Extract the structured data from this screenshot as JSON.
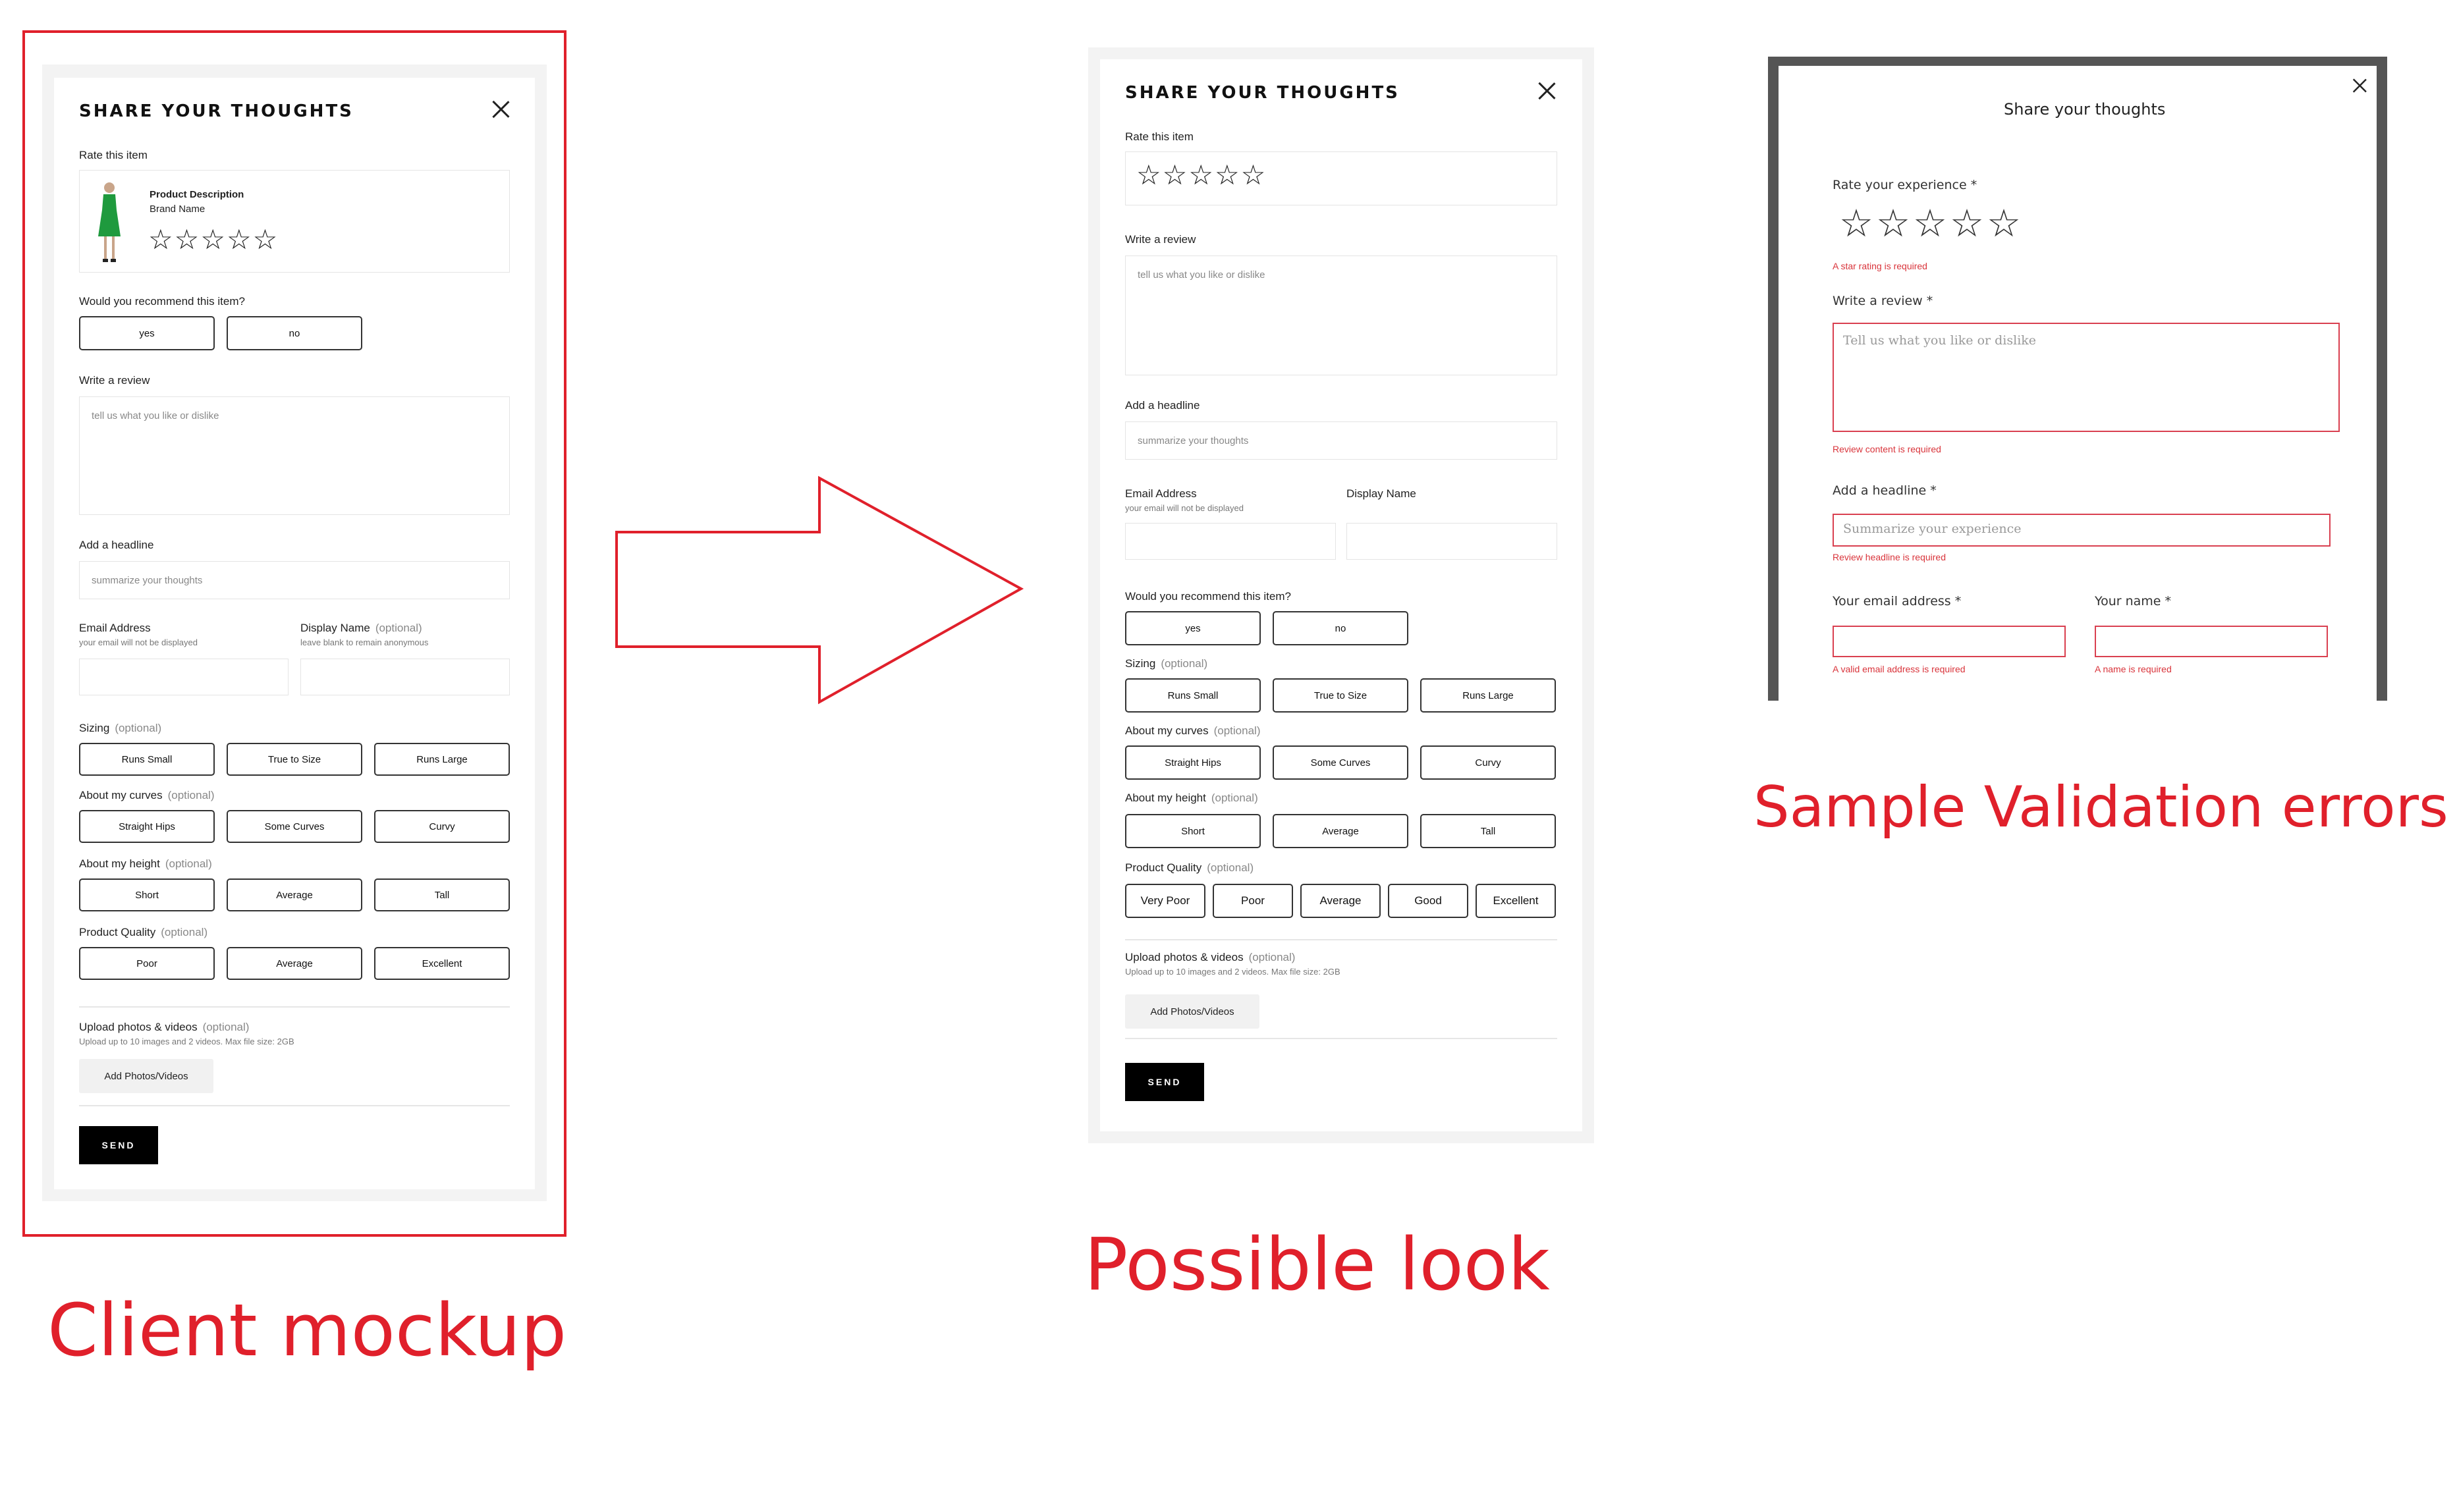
{
  "mockup": {
    "title": "SHARE YOUR THOUGHTS",
    "rate_label": "Rate this item",
    "product_description": "Product Description",
    "brand_name": "Brand Name",
    "stars": [
      "☆",
      "☆",
      "☆",
      "☆",
      "☆"
    ],
    "recommend_label": "Would you recommend this item?",
    "yes": "yes",
    "no": "no",
    "review_label": "Write a review",
    "review_placeholder": "tell us what you like or dislike",
    "headline_label": "Add a headline",
    "headline_placeholder": "summarize your thoughts",
    "email_label": "Email Address",
    "email_hint": "your email will not be displayed",
    "display_label": "Display Name",
    "display_opt": "(optional)",
    "display_hint": "leave blank to remain anonymous",
    "sizing_label": "Sizing",
    "sizing_opt": "(optional)",
    "sizing_options": [
      "Runs Small",
      "True to Size",
      "Runs Large"
    ],
    "curves_label": "About my curves",
    "curves_opt": "(optional)",
    "curves_options": [
      "Straight Hips",
      "Some Curves",
      "Curvy"
    ],
    "height_label": "About my height",
    "height_opt": "(optional)",
    "height_options": [
      "Short",
      "Average",
      "Tall"
    ],
    "quality_label": "Product Quality",
    "quality_opt": "(optional)",
    "quality_options": [
      "Poor",
      "Average",
      "Excellent"
    ],
    "upload_label": "Upload photos & videos",
    "upload_opt": "(optional)",
    "upload_hint": "Upload up to 10 images and 2 videos. Max file size: 2GB",
    "add_photos": "Add Photos/Videos",
    "send": "SEND"
  },
  "possible": {
    "title": "SHARE YOUR THOUGHTS",
    "rate_label": "Rate this item",
    "stars": [
      "☆",
      "☆",
      "☆",
      "☆",
      "☆"
    ],
    "review_label": "Write a review",
    "review_placeholder": "tell us what you like or dislike",
    "headline_label": "Add a headline",
    "headline_placeholder": "summarize your thoughts",
    "email_label": "Email Address",
    "email_hint": "your email will not be displayed",
    "display_label": "Display Name",
    "recommend_label": "Would you recommend this item?",
    "yes": "yes",
    "no": "no",
    "sizing_label": "Sizing",
    "sizing_opt": "(optional)",
    "sizing_options": [
      "Runs Small",
      "True to Size",
      "Runs Large"
    ],
    "curves_label": "About my curves",
    "curves_opt": "(optional)",
    "curves_options": [
      "Straight Hips",
      "Some Curves",
      "Curvy"
    ],
    "height_label": "About my height",
    "height_opt": "(optional)",
    "height_options": [
      "Short",
      "Average",
      "Tall"
    ],
    "quality_label": "Product Quality",
    "quality_opt": "(optional)",
    "quality_options": [
      "Very Poor",
      "Poor",
      "Average",
      "Good",
      "Excellent"
    ],
    "upload_label": "Upload photos & videos",
    "upload_opt": "(optional)",
    "upload_hint": "Upload up to 10 images and 2 videos. Max file size: 2GB",
    "add_photos": "Add Photos/Videos",
    "send": "SEND"
  },
  "validation": {
    "title": "Share your thoughts",
    "rate_label": "Rate your experience *",
    "stars": [
      "☆",
      "☆",
      "☆",
      "☆",
      "☆"
    ],
    "rating_error": "A star rating is required",
    "review_label": "Write a review *",
    "review_placeholder": "Tell us what you like or dislike",
    "review_error": "Review content is required",
    "headline_label": "Add a headline *",
    "headline_placeholder": "Summarize your experience",
    "headline_error": "Review headline is required",
    "email_label": "Your email address *",
    "email_error": "A valid email address is required",
    "name_label": "Your name *",
    "name_error": "A name is required"
  },
  "captions": {
    "client": "Client mockup",
    "possible": "Possible look",
    "validation": "Sample Validation errors"
  },
  "colors": {
    "accent_red": "#e0202b",
    "error_red": "#d9343b"
  }
}
